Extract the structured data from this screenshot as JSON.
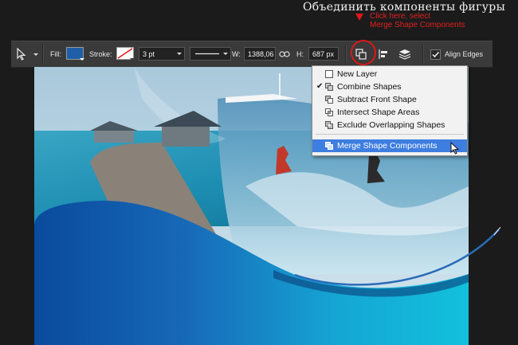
{
  "annotation": {
    "title": "Объединить компоненты фигуры",
    "note_line1": "Click here, select",
    "note_line2": "Merge Shape Components"
  },
  "toolbar": {
    "fill_label": "Fill:",
    "fill_color": "#1f5fa8",
    "stroke_label": "Stroke:",
    "stroke_width": "3 pt",
    "width_label": "W:",
    "width_value": "1388,06",
    "height_label": "H:",
    "height_value": "687 px",
    "align_edges_label": "Align Edges",
    "align_edges_checked": true
  },
  "menu": {
    "items": [
      {
        "label": "New Layer",
        "checked": false
      },
      {
        "label": "Combine Shapes",
        "checked": true
      },
      {
        "label": "Subtract Front Shape",
        "checked": false
      },
      {
        "label": "Intersect Shape Areas",
        "checked": false
      },
      {
        "label": "Exclude Overlapping Shapes",
        "checked": false
      },
      {
        "label": "Merge Shape Components",
        "checked": false,
        "highlighted": true
      }
    ]
  },
  "colors": {
    "highlight_circle": "#d91818",
    "menu_selection": "#3e7ee0",
    "annotation_red": "#e02020"
  }
}
